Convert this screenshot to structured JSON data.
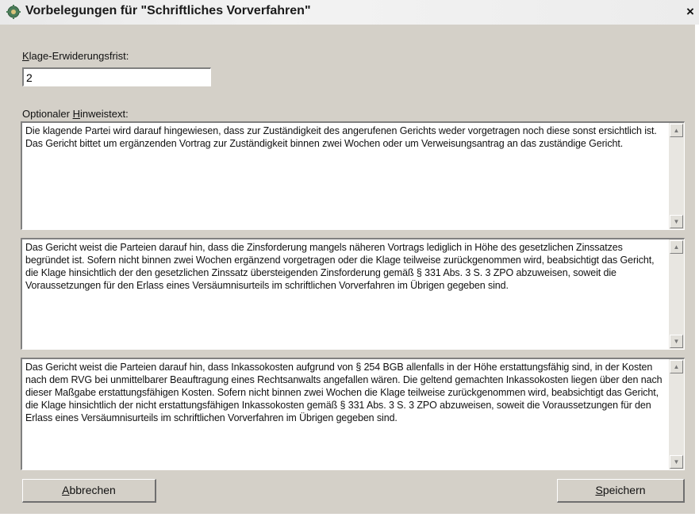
{
  "window": {
    "title": "Vorbelegungen für \"Schriftliches Vorverfahren\"",
    "close_symbol": "×"
  },
  "fields": {
    "frist_label": "Klage-Erwiderungsfrist:",
    "frist_value": "2",
    "hinweis_label": "Optionaler Hinweistext:"
  },
  "texts": [
    "Die klagende Partei wird darauf hingewiesen, dass zur Zuständigkeit des angerufenen Gerichts weder vorgetragen noch diese sonst ersichtlich ist. Das Gericht bittet um ergänzenden Vortrag zur Zuständigkeit binnen zwei Wochen oder um Verweisungsantrag an das zuständige Gericht.",
    "Das Gericht weist die Parteien darauf hin, dass die Zinsforderung mangels näheren Vortrags lediglich in Höhe des gesetzlichen Zinssatzes begründet ist. Sofern nicht binnen zwei Wochen ergänzend vorgetragen oder die Klage teilweise zurückgenommen wird, beabsichtigt das Gericht, die Klage hinsichtlich der den gesetzlichen Zinssatz übersteigenden Zinsforderung gemäß § 331 Abs. 3 S. 3 ZPO abzuweisen, soweit die Voraussetzungen für den Erlass eines Versäumnisurteils im schriftlichen Vorverfahren im Übrigen gegeben sind.",
    "Das Gericht weist die Parteien darauf hin, dass Inkassokosten aufgrund von § 254 BGB allenfalls in der Höhe erstattungsfähig sind, in der Kosten nach dem RVG bei unmittelbarer Beauftragung eines Rechtsanwalts angefallen wären. Die geltend gemachten Inkassokosten liegen über den nach dieser Maßgabe erstattungsfähigen Kosten. Sofern nicht binnen zwei Wochen die Klage teilweise zurückgenommen wird, beabsichtigt das Gericht, die Klage hinsichtlich der nicht erstattungsfähigen Inkassokosten gemäß § 331 Abs. 3 S. 3 ZPO abzuweisen, soweit die Voraussetzungen für den Erlass eines Versäumnisurteils im schriftlichen Vorverfahren im Übrigen gegeben sind."
  ],
  "buttons": {
    "cancel": "Abbrechen",
    "save": "Speichern"
  },
  "icons": {
    "title": "app-gear-icon",
    "scroll_up": "scroll-up-arrow-icon",
    "scroll_down": "scroll-down-arrow-icon"
  },
  "colors": {
    "dialog_bg": "#d4d0c8",
    "titlebar_bg": "#ececec"
  }
}
